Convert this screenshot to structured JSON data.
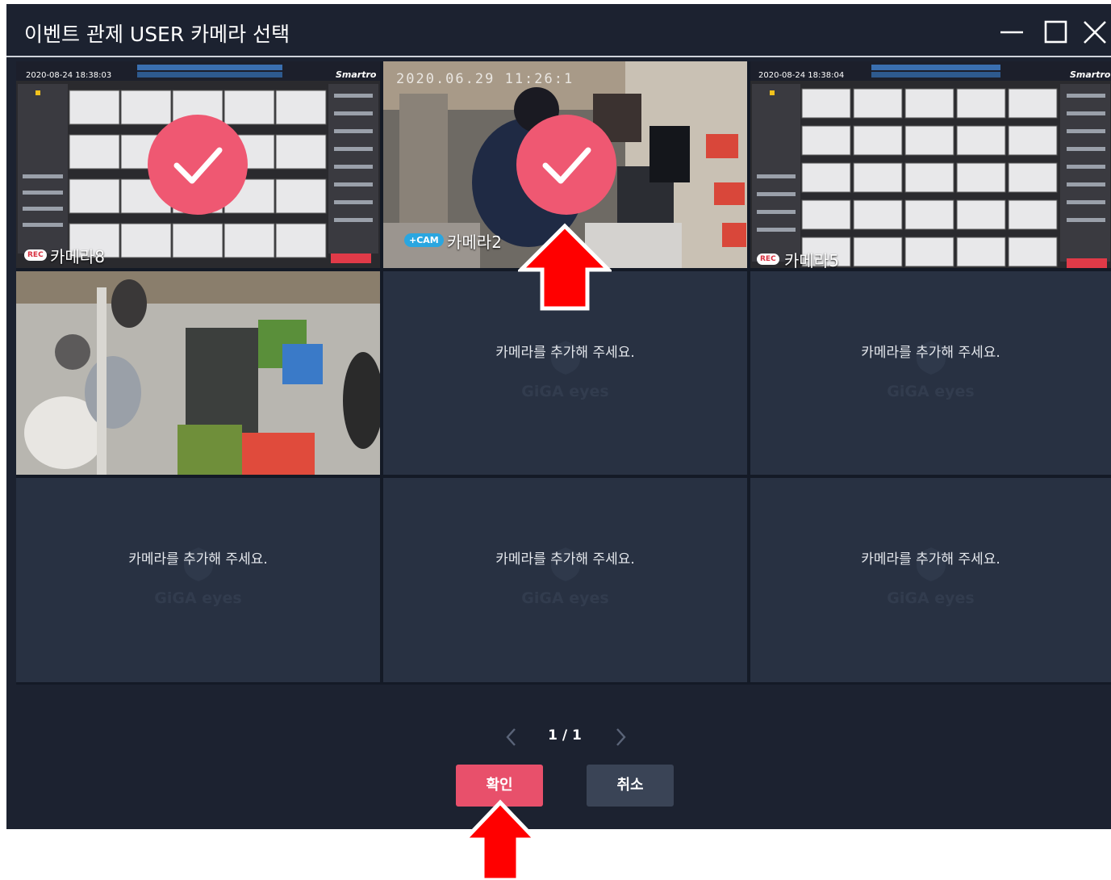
{
  "window": {
    "title": "이벤트 관제 USER 카메라 선택",
    "controls": {
      "minimize": "minimize-icon",
      "maximize": "maximize-icon",
      "close": "close-icon"
    }
  },
  "cameras": [
    {
      "slot": 1,
      "name": "카메라8",
      "selected": true,
      "feed": "pos-screen",
      "rec_badge": "REC",
      "pos_date": "2020-08-24 18:38:03",
      "pos_brand": "Smartro"
    },
    {
      "slot": 2,
      "name": "카메라2",
      "selected": true,
      "feed": "store-counter",
      "cam_badge": "+CAM",
      "timestamp": "2020.06.29 11:26:1"
    },
    {
      "slot": 3,
      "name": "카메라5",
      "selected": false,
      "feed": "pos-screen",
      "rec_badge": "REC",
      "pos_date": "2020-08-24 18:38:04",
      "pos_brand": "Smartro"
    },
    {
      "slot": 4,
      "name": "",
      "selected": false,
      "feed": "store-overhead"
    }
  ],
  "empty_slot": {
    "text": "카메라를 추가해 주세요.",
    "watermark": "GiGA eyes"
  },
  "pagination": {
    "text": "1 / 1"
  },
  "buttons": {
    "confirm": "확인",
    "cancel": "취소"
  },
  "colors": {
    "window_bg": "#1c2230",
    "cell_bg": "#283142",
    "check_accent": "#ef5872",
    "confirm_button": "#e8506b",
    "cancel_button": "#3a4456",
    "annotation_arrow": "#ff0000"
  }
}
